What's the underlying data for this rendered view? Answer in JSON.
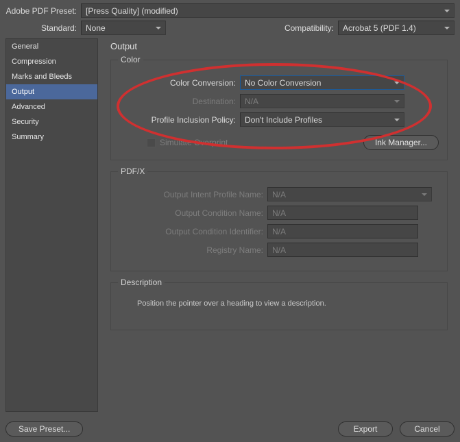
{
  "top": {
    "preset_label": "Adobe PDF Preset:",
    "preset_value": "[Press Quality] (modified)",
    "standard_label": "Standard:",
    "standard_value": "None",
    "compat_label": "Compatibility:",
    "compat_value": "Acrobat 5 (PDF 1.4)"
  },
  "sidebar": {
    "items": [
      {
        "label": "General"
      },
      {
        "label": "Compression"
      },
      {
        "label": "Marks and Bleeds"
      },
      {
        "label": "Output"
      },
      {
        "label": "Advanced"
      },
      {
        "label": "Security"
      },
      {
        "label": "Summary"
      }
    ],
    "active_index": 3
  },
  "panel": {
    "title": "Output",
    "color": {
      "legend": "Color",
      "conversion_label": "Color Conversion:",
      "conversion_value": "No Color Conversion",
      "destination_label": "Destination:",
      "destination_value": "N/A",
      "policy_label": "Profile Inclusion Policy:",
      "policy_value": "Don't Include Profiles",
      "simulate_label": "Simulate Overprint",
      "ink_manager_label": "Ink Manager..."
    },
    "pdfx": {
      "legend": "PDF/X",
      "profile_label": "Output Intent Profile Name:",
      "profile_value": "N/A",
      "cond_label": "Output Condition Name:",
      "cond_value": "N/A",
      "iden_label": "Output Condition Identifier:",
      "iden_value": "N/A",
      "reg_label": "Registry Name:",
      "reg_value": "N/A"
    },
    "description": {
      "legend": "Description",
      "text": "Position the pointer over a heading to view a description."
    }
  },
  "buttons": {
    "save_preset": "Save Preset...",
    "export": "Export",
    "cancel": "Cancel"
  }
}
